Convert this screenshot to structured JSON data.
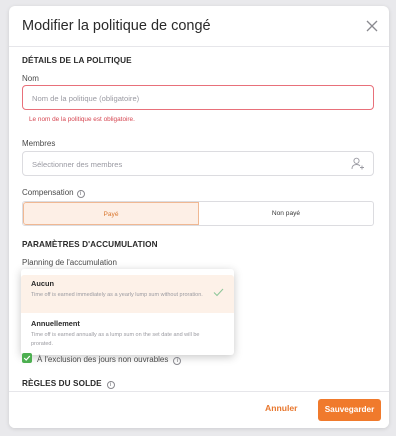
{
  "modal": {
    "title": "Modifier la politique de congé"
  },
  "details": {
    "section_title": "DÉTAILS DE LA POLITIQUE",
    "name_label": "Nom",
    "name_placeholder": "Nom de la politique (obligatoire)",
    "name_error": "Le nom de la politique est obligatoire.",
    "members_label": "Membres",
    "members_placeholder": "Sélectionner des membres",
    "compensation_label": "Compensation",
    "compensation_options": [
      "Payé",
      "Non payé"
    ],
    "compensation_selected": "Payé"
  },
  "accrual": {
    "section_title": "PARAMÈTRES D'ACCUMULATION",
    "schedule_label": "Planning de l'accumulation",
    "options": [
      {
        "title": "Aucun",
        "description": "Time off is earned immediately as a yearly lump sum without proration.",
        "selected": true
      },
      {
        "title": "Annuellement",
        "description": "Time off is earned annually as a lump sum on the set date and will be prorated.",
        "selected": false
      }
    ],
    "exclude_nonworking_label": "À l'exclusion des jours non ouvrables",
    "exclude_nonworking_checked": true
  },
  "balance": {
    "section_title": "RÈGLES DU SOLDE"
  },
  "footer": {
    "cancel_label": "Annuler",
    "save_label": "Sauvegarder"
  },
  "colors": {
    "accent": "#f07a2c",
    "error": "#d64550",
    "check": "#4caf50"
  }
}
